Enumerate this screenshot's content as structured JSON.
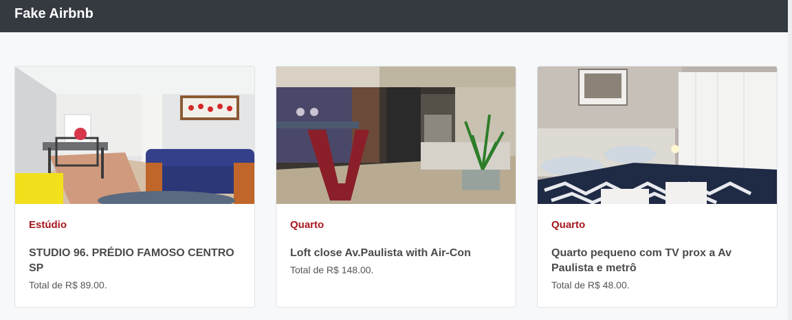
{
  "app": {
    "brand": "Fake Airbnb"
  },
  "listings": [
    {
      "type": "Estúdio",
      "title": "STUDIO 96. PRÉDIO FAMOSO CENTRO SP",
      "price": "Total de R$ 89.00.",
      "image": "studio-living-room-photo"
    },
    {
      "type": "Quarto",
      "title": "Loft close Av.Paulista with Air-Con",
      "price": "Total de R$ 148.00.",
      "image": "loft-interior-photo"
    },
    {
      "type": "Quarto",
      "title": "Quarto pequeno com TV prox a Av Paulista e metrô",
      "price": "Total de R$ 48.00.",
      "image": "bedroom-photo"
    }
  ],
  "colors": {
    "navbar": "#343a40",
    "type_label": "#a8171d",
    "page_background": "#f7f8fa"
  }
}
